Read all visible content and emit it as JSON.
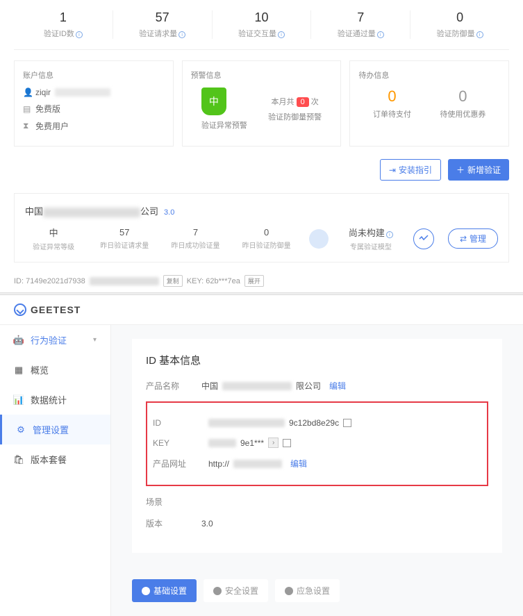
{
  "stats": [
    {
      "value": "1",
      "label": "验证ID数"
    },
    {
      "value": "57",
      "label": "验证请求量"
    },
    {
      "value": "10",
      "label": "验证交互量"
    },
    {
      "value": "7",
      "label": "验证通过量"
    },
    {
      "value": "0",
      "label": "验证防御量"
    }
  ],
  "panels": {
    "account_title": "账户信息",
    "account": {
      "user_prefix": "ziqir",
      "plan": "免费版",
      "user_type": "免费用户"
    },
    "warning_title": "预警信息",
    "warning": {
      "shield": "中",
      "sub1": "验证异常预警",
      "month_prefix": "本月共",
      "month_count": "0",
      "month_suffix": "次",
      "sub2": "验证防御量预警"
    },
    "todo_title": "待办信息",
    "todo": {
      "pending_orders": "0",
      "pending_label": "订单待支付",
      "coupons": "0",
      "coupons_label": "待使用优惠券"
    }
  },
  "buttons": {
    "install": "安装指引",
    "add": "新增验证",
    "manage": "管理"
  },
  "company": {
    "prefix": "中国",
    "suffix": "公司",
    "version": "3.0",
    "stats": [
      {
        "value": "中",
        "label": "验证异常等级"
      },
      {
        "value": "57",
        "label": "昨日验证请求量"
      },
      {
        "value": "7",
        "label": "昨日成功验证量"
      },
      {
        "value": "0",
        "label": "昨日验证防御量"
      }
    ],
    "model_status": "尚未构建",
    "model_label": "专属验证模型"
  },
  "idkey": {
    "id_prefix": "ID: 7149e2021d7938",
    "copy": "复制",
    "key_prefix": "KEY: 62b***7ea",
    "expand": "展开"
  },
  "brand": "GEETEST",
  "sidebar": {
    "main_nav": "行为验证",
    "items": [
      {
        "label": "概览"
      },
      {
        "label": "数据统计"
      },
      {
        "label": "管理设置"
      },
      {
        "label": "版本套餐"
      }
    ]
  },
  "basic_info": {
    "title": "ID 基本信息",
    "product_name_label": "产品名称",
    "product_prefix": "中国",
    "product_suffix": "限公司",
    "edit": "编辑",
    "id_label": "ID",
    "id_suffix": "9c12bd8e29c",
    "key_label": "KEY",
    "key_value": "9e1***",
    "url_label": "产品网址",
    "url_prefix": "http://",
    "scene_label": "场景",
    "version_label": "版本",
    "version_value": "3.0"
  },
  "tabs": {
    "basic": "基础设置",
    "security": "安全设置",
    "app": "应急设置"
  }
}
